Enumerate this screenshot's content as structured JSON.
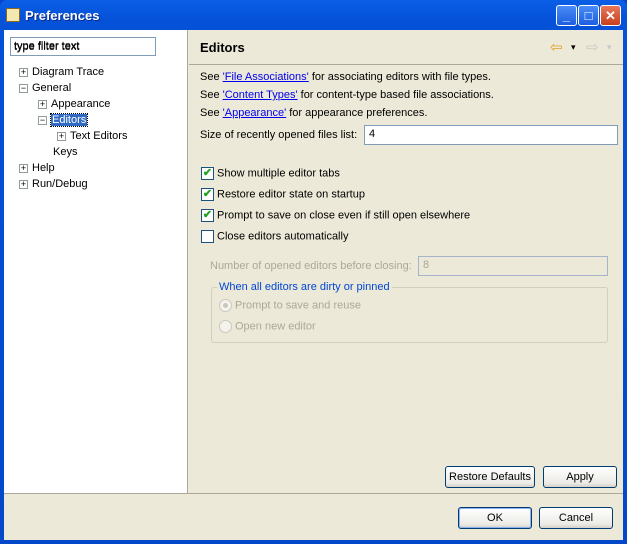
{
  "window": {
    "title": "Preferences",
    "minimize": "_",
    "maximize": "□",
    "close": "✕"
  },
  "filter": {
    "placeholder": "type filter text",
    "value": "type filter text"
  },
  "tree": [
    {
      "label": "Diagram Trace",
      "expander": "+"
    },
    {
      "label": "General",
      "expander": "−"
    },
    {
      "label": "Appearance",
      "expander": "+"
    },
    {
      "label": "Editors",
      "expander": "−",
      "selected": true
    },
    {
      "label": "Text Editors",
      "expander": "+"
    },
    {
      "label": "Keys"
    },
    {
      "label": "Help",
      "expander": "+"
    },
    {
      "label": "Run/Debug",
      "expander": "+"
    }
  ],
  "page": {
    "title": "Editors",
    "nav_back": "⇦",
    "nav_forward": "⇨",
    "dropdown": "▾",
    "links": [
      {
        "pre": "See ",
        "link": "'File Associations'",
        "post": " for associating editors with file types."
      },
      {
        "pre": "See ",
        "link": "'Content Types'",
        "post": " for content-type based file associations."
      },
      {
        "pre": "See ",
        "link": "'Appearance'",
        "post": " for appearance preferences."
      }
    ],
    "recent_label": "Size of recently opened files list:",
    "recent_value": "4",
    "checkboxes": [
      {
        "label": "Show multiple editor tabs",
        "checked": true
      },
      {
        "label": "Restore editor state on startup",
        "checked": true
      },
      {
        "label": "Prompt to save on close even if still open elsewhere",
        "checked": true
      },
      {
        "label": "Close editors automatically",
        "checked": false
      }
    ],
    "check_mark": "✔",
    "num_editors_label": "Number of opened editors before closing:",
    "num_editors_value": "8",
    "group_title": "When all editors are dirty or pinned",
    "radios": [
      {
        "label": "Prompt to save and reuse",
        "selected": true
      },
      {
        "label": "Open new editor",
        "selected": false
      }
    ],
    "restore_defaults": "Restore Defaults",
    "apply": "Apply"
  },
  "dialog": {
    "ok": "OK",
    "cancel": "Cancel"
  }
}
